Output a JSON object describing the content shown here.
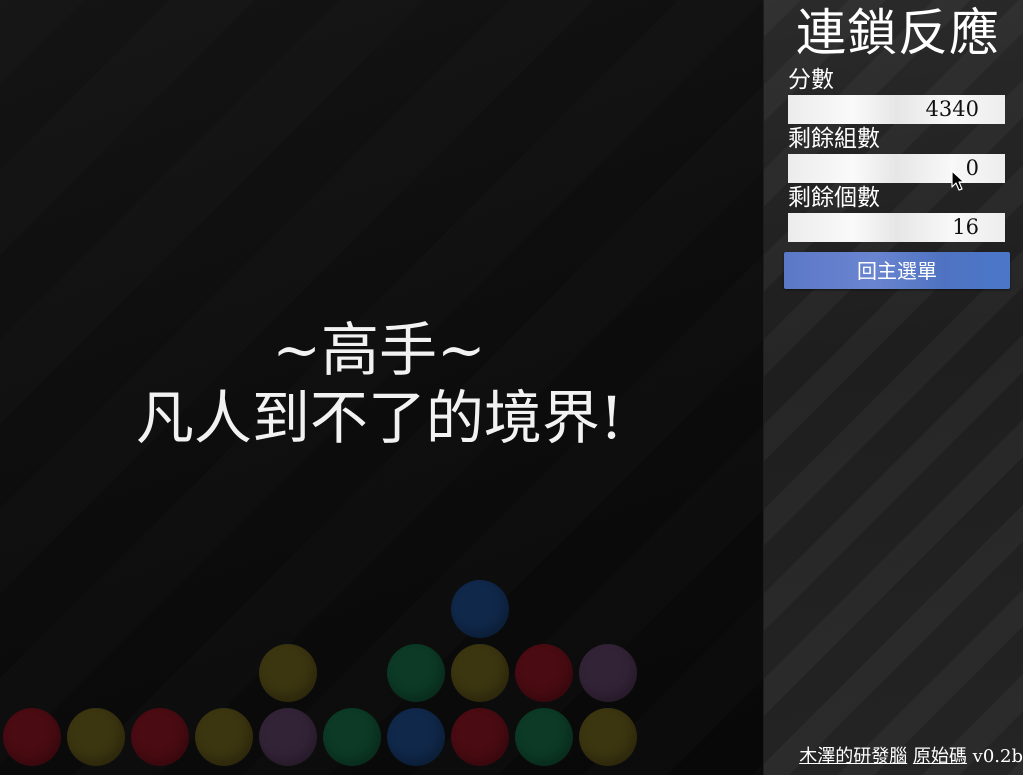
{
  "board": {
    "message": {
      "rank": "~高手~",
      "comment": "凡人到不了的境界!"
    },
    "palette": {
      "red": "#4a0b12",
      "yellow": "#3b3510",
      "green": "#0c3a26",
      "blue": "#10284a",
      "purple": "#332337"
    },
    "balls": [
      {
        "col": 0,
        "row": 0,
        "color": "red"
      },
      {
        "col": 1,
        "row": 0,
        "color": "yellow"
      },
      {
        "col": 2,
        "row": 0,
        "color": "red"
      },
      {
        "col": 3,
        "row": 0,
        "color": "yellow"
      },
      {
        "col": 4,
        "row": 0,
        "color": "purple"
      },
      {
        "col": 5,
        "row": 0,
        "color": "green"
      },
      {
        "col": 6,
        "row": 0,
        "color": "blue"
      },
      {
        "col": 7,
        "row": 0,
        "color": "red"
      },
      {
        "col": 8,
        "row": 0,
        "color": "green"
      },
      {
        "col": 9,
        "row": 0,
        "color": "yellow"
      },
      {
        "col": 4,
        "row": 1,
        "color": "yellow"
      },
      {
        "col": 6,
        "row": 1,
        "color": "green"
      },
      {
        "col": 7,
        "row": 1,
        "color": "yellow"
      },
      {
        "col": 8,
        "row": 1,
        "color": "red"
      },
      {
        "col": 9,
        "row": 1,
        "color": "purple"
      },
      {
        "col": 7,
        "row": 2,
        "color": "blue"
      }
    ]
  },
  "panel": {
    "title": "連鎖反應",
    "stats": [
      {
        "label": "分數",
        "value": "4340"
      },
      {
        "label": "剩餘組數",
        "value": "0"
      },
      {
        "label": "剩餘個數",
        "value": "16"
      }
    ],
    "menu_button": "回主選單",
    "footer": {
      "author_link": "木澤的研發腦",
      "source_link": "原始碼",
      "version": "v0.2b"
    }
  }
}
